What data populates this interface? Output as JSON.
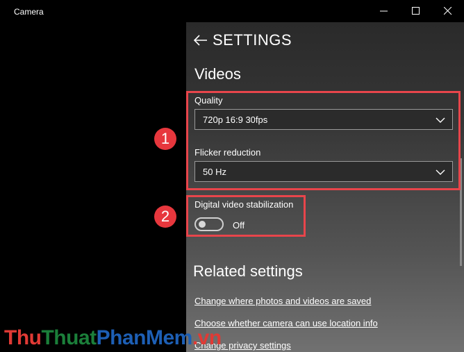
{
  "window": {
    "title": "Camera"
  },
  "panel": {
    "title": "SETTINGS"
  },
  "videos": {
    "heading": "Videos",
    "quality": {
      "label": "Quality",
      "value": "720p 16:9 30fps"
    },
    "flicker": {
      "label": "Flicker reduction",
      "value": "50 Hz"
    },
    "stabilization": {
      "label": "Digital video stabilization",
      "state": "Off",
      "on": false
    }
  },
  "related": {
    "heading": "Related settings",
    "links": [
      "Change where photos and videos are saved",
      "Choose whether camera can use location info",
      "Change privacy settings"
    ]
  },
  "annotations": {
    "badge1": "1",
    "badge2": "2",
    "color": "#e7373d"
  },
  "watermark": {
    "part1": "Thu",
    "part2": "Thuat",
    "part3": "PhanMem",
    "part4": ".vn"
  }
}
